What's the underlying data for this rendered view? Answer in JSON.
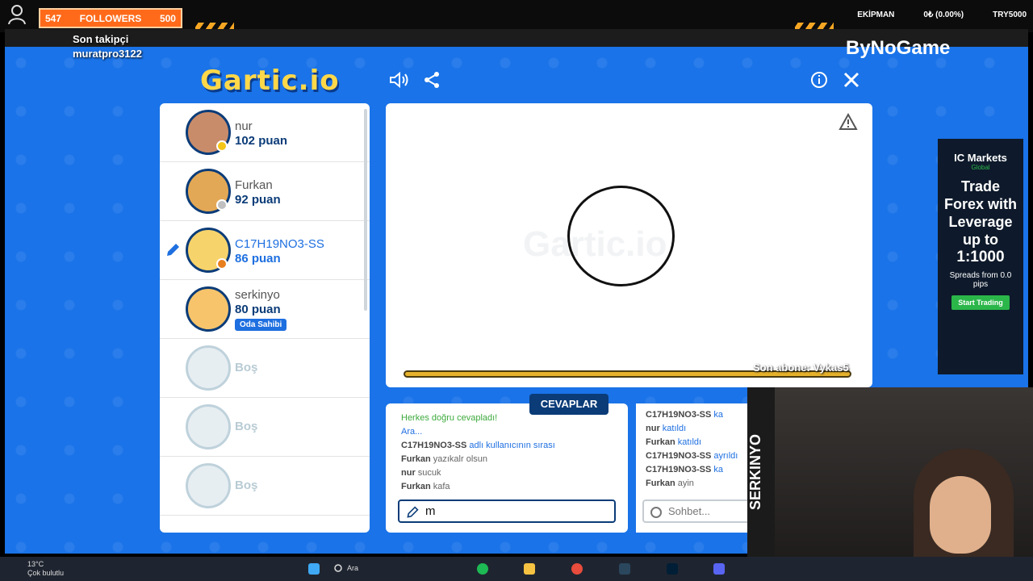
{
  "overlay": {
    "followers_count": "547",
    "followers_label": "FOLLOWERS",
    "followers_goal": "500",
    "last_follower_label": "Son takipçi",
    "last_follower_name": "muratpro3122",
    "equipment_label": "EKİPMAN",
    "change_label": "0₺ (0.00%)",
    "currency_label": "TRY5000",
    "sponsor": "ByNoGame",
    "last_sub": "Son abone: Vykas5"
  },
  "game": {
    "logo": "Gartic.io",
    "canvas_watermark": "Gartic.io",
    "players": [
      {
        "name": "nur",
        "score": "102 puan",
        "skin": "#c98c6a",
        "dot": "#f5c518"
      },
      {
        "name": "Furkan",
        "score": "92 puan",
        "skin": "#e3a855",
        "dot": "#c0c0c0"
      },
      {
        "name": "C17H19NO3-SS",
        "score": "86 puan",
        "skin": "#f7d36b",
        "dot": "#e87f1e",
        "drawing": true
      },
      {
        "name": "serkinyo",
        "score": "80 puan",
        "skin": "#f7c46b",
        "badge": "Oda Sahibi"
      },
      {
        "name": "Boş"
      },
      {
        "name": "Boş"
      },
      {
        "name": "Boş"
      }
    ],
    "answers_tab": "CEVAPLAR",
    "answers": [
      {
        "text": "Herkes doğru cevapladı!",
        "style": "green"
      },
      {
        "text": "Ara...",
        "style": "blue"
      },
      {
        "user": "C17H19NO3-SS",
        "text": " adlı kullanıcının sırası",
        "style": "blue"
      },
      {
        "user": "Furkan",
        "text": " yazıkalr olsun"
      },
      {
        "user": "nur",
        "text": " sucuk"
      },
      {
        "user": "Furkan",
        "text": " kafa"
      }
    ],
    "answer_value": "m",
    "chat": [
      {
        "user": "C17H19NO3-SS",
        "text": " ka",
        "style": "blue"
      },
      {
        "user": "nur",
        "text": " katıldı",
        "style": "blue"
      },
      {
        "user": "Furkan",
        "text": " katıldı",
        "style": "blue"
      },
      {
        "user": "C17H19NO3-SS",
        "text": " ayrıldı",
        "style": "blue"
      },
      {
        "user": "C17H19NO3-SS",
        "text": " ka",
        "style": "blue"
      },
      {
        "user": "Furkan",
        "text": " ayin"
      }
    ],
    "chat_placeholder": "Sohbet..."
  },
  "ad": {
    "brand": "IC Markets",
    "sub": "Global",
    "headline": "Trade Forex with Leverage up to",
    "ratio": "1:1000",
    "spreads": "Spreads from 0.0 pips",
    "cta": "Start Trading"
  },
  "webcam": {
    "label": "SERKINYO"
  },
  "taskbar": {
    "temp": "13°C",
    "weather": "Çok bulutlu",
    "search": "Ara"
  }
}
